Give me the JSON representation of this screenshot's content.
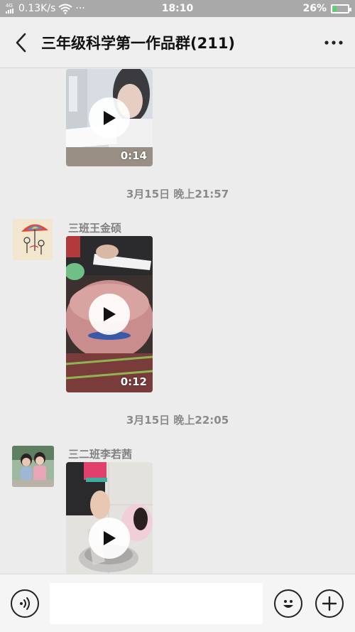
{
  "status_bar": {
    "network": "4G",
    "speed": "0.13K/s",
    "more": "···",
    "time": "18:10",
    "battery": "26%",
    "battery_level": 0.26
  },
  "header": {
    "title": "三年级科学第一作品群(211)"
  },
  "messages": [
    {
      "duration": "0:14"
    },
    {
      "timestamp": "3月15日 晚上21:57",
      "sender": "三班王金硕",
      "duration": "0:12"
    },
    {
      "timestamp": "3月15日 晚上22:05",
      "sender": "三二班李若茜"
    }
  ],
  "icons": {
    "back": "chevron-left-icon",
    "more": "more-dots-icon",
    "play": "play-icon",
    "voice": "voice-icon",
    "emoji": "emoji-icon",
    "add": "plus-icon"
  }
}
